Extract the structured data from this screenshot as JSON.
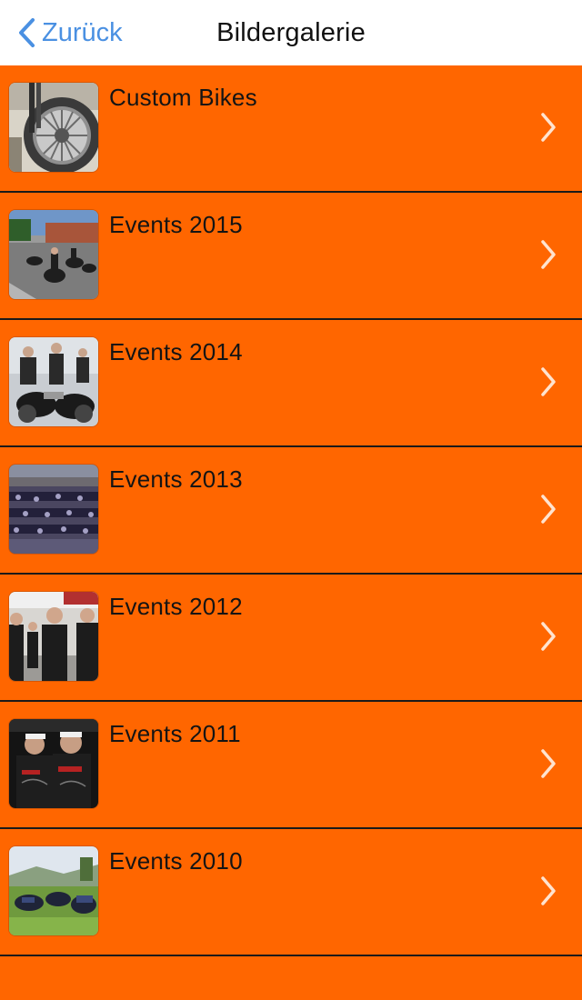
{
  "nav": {
    "back_label": "Zurück",
    "title": "Bildergalerie"
  },
  "colors": {
    "accent": "#FF6600",
    "link": "#4A90E2",
    "navbar_bg": "#FFFFFF",
    "separator": "#1a1a1a"
  },
  "gallery": {
    "items": [
      {
        "label": "Custom Bikes",
        "thumb": "motorcycle-wheel-photo"
      },
      {
        "label": "Events 2015",
        "thumb": "bike-rally-photo"
      },
      {
        "label": "Events 2014",
        "thumb": "riders-with-motorcycles-photo"
      },
      {
        "label": "Events 2013",
        "thumb": "parked-motorcycles-photo"
      },
      {
        "label": "Events 2012",
        "thumb": "people-group-photo"
      },
      {
        "label": "Events 2011",
        "thumb": "two-bikers-photo"
      },
      {
        "label": "Events 2010",
        "thumb": "bikes-on-meadow-photo"
      }
    ]
  }
}
